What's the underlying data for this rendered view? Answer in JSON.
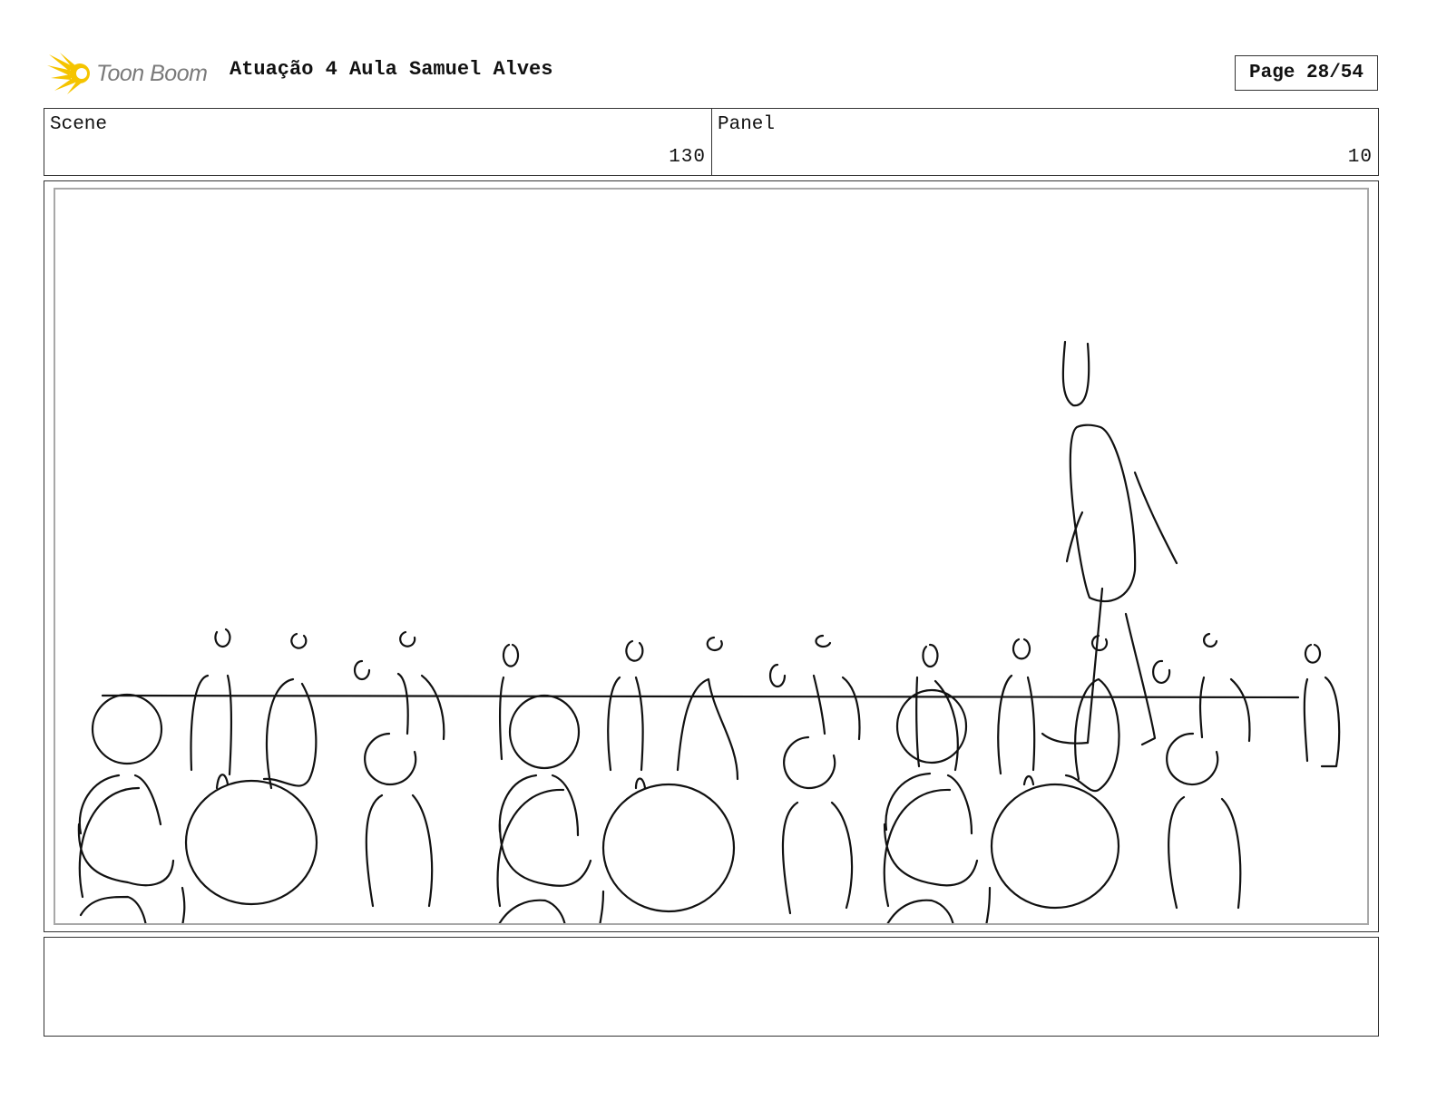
{
  "header": {
    "logo_text": "Toon Boom",
    "logo_icon": "toon-boom-burst-icon",
    "title": "Atuação 4 Aula Samuel Alves",
    "page": "Page 28/54"
  },
  "info": {
    "scene_label": "Scene",
    "scene_value": "130",
    "panel_label": "Panel",
    "panel_value": "10"
  },
  "panel": {
    "drawing_description_icon": "storyboard-sketch"
  },
  "notes": {
    "text": ""
  },
  "colors": {
    "logo_yellow": "#F5C400",
    "logo_text": "#7A7A7A",
    "frame_border": "#333333",
    "inner_border": "#A8A8A8",
    "sketch_stroke": "#111111"
  }
}
